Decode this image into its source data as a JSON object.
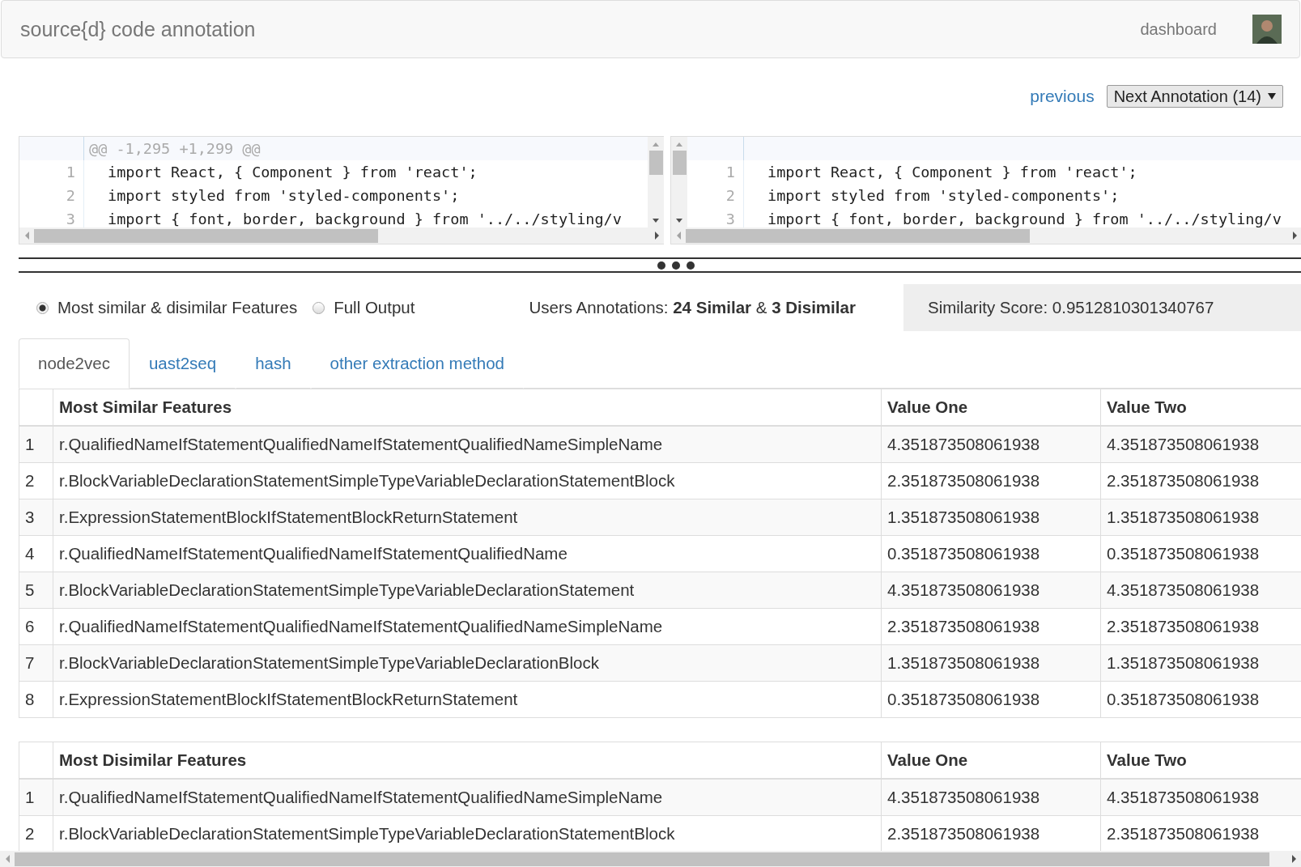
{
  "header": {
    "title": "source{d} code annotation",
    "links": [
      {
        "label": "dashboard"
      }
    ]
  },
  "nav": {
    "previous": "previous",
    "next": "Next Annotation (14)"
  },
  "diff": {
    "hunk": "@@ -1,295 +1,299 @@",
    "left": [
      {
        "number": "1",
        "code": "import React, { Component } from 'react';"
      },
      {
        "number": "2",
        "code": "import styled from 'styled-components';"
      },
      {
        "number": "3",
        "code": "import { font, border, background } from '../../styling/v"
      }
    ],
    "right": [
      {
        "number": "1",
        "code": "import React, { Component } from 'react';"
      },
      {
        "number": "2",
        "code": "import styled from 'styled-components';"
      },
      {
        "number": "3",
        "code": "import { font, border, background } from '../../styling/v"
      }
    ]
  },
  "options": [
    {
      "label": "Most similar & disimilar Features",
      "selected": true
    },
    {
      "label": "Full Output",
      "selected": false
    }
  ],
  "users_annotations": "Users Annotations: **24 Similar** & **3 Disimilar**",
  "similarity_score": "Similarity Score: 0.9512810301340767",
  "tabs": [
    {
      "label": "node2vec",
      "selected": true
    },
    {
      "label": "uast2seq",
      "selected": false
    },
    {
      "label": "hash",
      "selected": false
    },
    {
      "label": "other extraction method",
      "selected": false
    }
  ],
  "tables": [
    {
      "columns": [
        "",
        "Most Similar Features",
        "Value One",
        "Value Two"
      ],
      "rows": [
        [
          "1",
          "r.QualifiedNameIfStatementQualifiedNameIfStatementQualifiedNameSimpleName",
          "4.351873508061938",
          "4.351873508061938"
        ],
        [
          "2",
          "r.BlockVariableDeclarationStatementSimpleTypeVariableDeclarationStatementBlock",
          "2.351873508061938",
          "2.351873508061938"
        ],
        [
          "3",
          "r.ExpressionStatementBlockIfStatementBlockReturnStatement",
          "1.351873508061938",
          "1.351873508061938"
        ],
        [
          "4",
          "r.QualifiedNameIfStatementQualifiedNameIfStatementQualifiedName",
          "0.351873508061938",
          "0.351873508061938"
        ],
        [
          "5",
          "r.BlockVariableDeclarationStatementSimpleTypeVariableDeclarationStatement",
          "4.351873508061938",
          "4.351873508061938"
        ],
        [
          "6",
          "r.QualifiedNameIfStatementQualifiedNameIfStatementQualifiedNameSimpleName",
          "2.351873508061938",
          "2.351873508061938"
        ],
        [
          "7",
          "r.BlockVariableDeclarationStatementSimpleTypeVariableDeclarationBlock",
          "1.351873508061938",
          "1.351873508061938"
        ],
        [
          "8",
          "r.ExpressionStatementBlockIfStatementBlockReturnStatement",
          "0.351873508061938",
          "0.351873508061938"
        ]
      ]
    },
    {
      "columns": [
        "",
        "Most Disimilar Features",
        "Value One",
        "Value Two"
      ],
      "rows": [
        [
          "1",
          "r.QualifiedNameIfStatementQualifiedNameIfStatementQualifiedNameSimpleName",
          "4.351873508061938",
          "4.351873508061938"
        ],
        [
          "2",
          "r.BlockVariableDeclarationStatementSimpleTypeVariableDeclarationStatementBlock",
          "2.351873508061938",
          "2.351873508061938"
        ]
      ]
    }
  ]
}
